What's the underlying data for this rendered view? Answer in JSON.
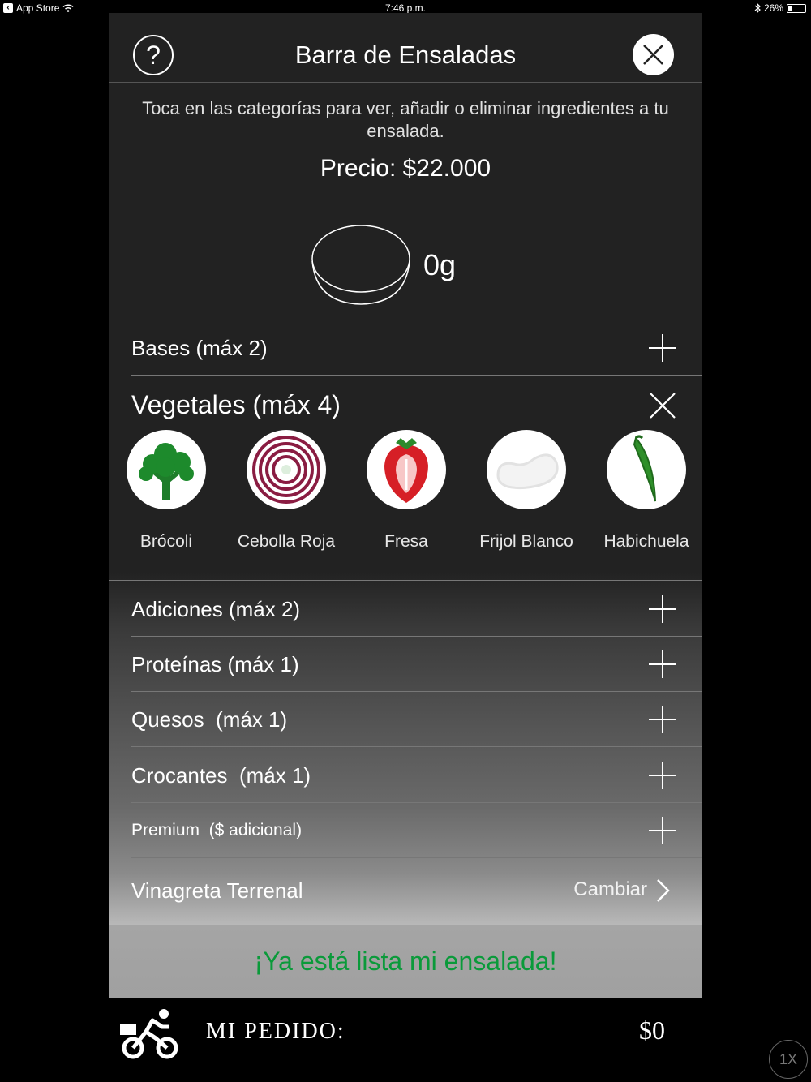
{
  "status_bar": {
    "back_app": "App Store",
    "time": "7:46 p.m.",
    "battery": "26%",
    "battery_level": 0.26
  },
  "header": {
    "help_glyph": "?",
    "title": "Barra de Ensaladas"
  },
  "instructions": "Toca en las categorías para ver, añadir o eliminar ingredientes a tu ensalada.",
  "price": "Precio: $22.000",
  "weight": "0g",
  "categories": {
    "bases": "Bases (máx 2)",
    "vegetales": "Vegetales (máx 4)",
    "adiciones": "Adiciones (máx 2)",
    "proteinas": "Proteínas (máx 1)",
    "quesos": "Quesos  (máx 1)",
    "crocantes": "Crocantes  (máx 1)",
    "premium": "Premium  ($ adicional)"
  },
  "vegetables": [
    {
      "name": "Brócoli",
      "icon": "broccoli-icon"
    },
    {
      "name": "Cebolla Roja",
      "icon": "red-onion-icon"
    },
    {
      "name": "Fresa",
      "icon": "strawberry-icon"
    },
    {
      "name": "Frijol Blanco",
      "icon": "white-bean-icon"
    },
    {
      "name": "Habichuela",
      "icon": "green-bean-icon"
    }
  ],
  "dressing": {
    "label": "Vinagreta Terrenal",
    "change": "Cambiar"
  },
  "ready_button": "¡Ya está lista mi ensalada!",
  "footer": {
    "order_label": "MI PEDIDO:",
    "total": "$0"
  },
  "zoom": "1X",
  "colors": {
    "ready_text": "#0a9a3a",
    "panel_bg": "#222222"
  }
}
